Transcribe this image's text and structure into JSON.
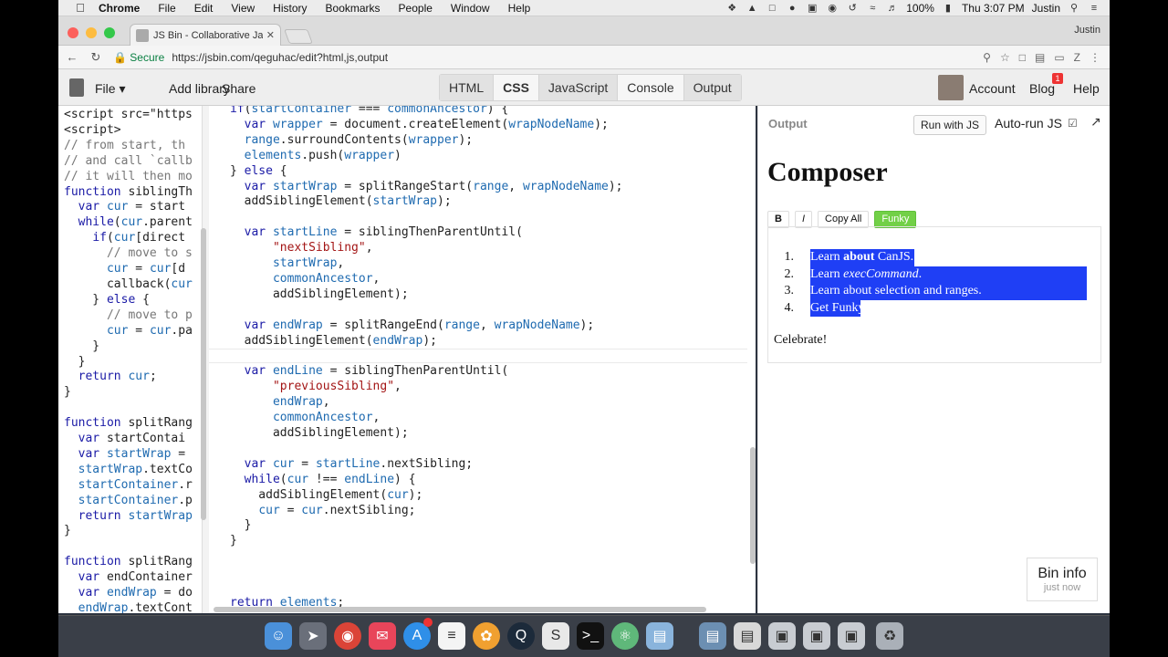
{
  "menubar": {
    "app_name": "Chrome",
    "items": [
      "File",
      "Edit",
      "View",
      "History",
      "Bookmarks",
      "People",
      "Window",
      "Help"
    ],
    "battery": "100%",
    "clock": "Thu 3:07 PM",
    "user": "Justin"
  },
  "browser": {
    "tab_title": "JS Bin - Collaborative JavaScr",
    "profile": "Justin",
    "secure_label": "Secure",
    "url": "https://jsbin.com/qeguhac/edit?html,js,output"
  },
  "toolbar": {
    "file": "File",
    "add_library": "Add library",
    "share": "Share",
    "panels": [
      "HTML",
      "CSS",
      "JavaScript",
      "Console",
      "Output"
    ],
    "account": "Account",
    "blog": "Blog",
    "blog_badge": "1",
    "help": "Help"
  },
  "html_editor": {
    "lines": [
      "<script src=\"https",
      "<script>",
      "// from start, th",
      "// and call `callb",
      "// it will then mo",
      "function siblingTh",
      "  var cur = start",
      "  while(cur.parent",
      "    if(cur[direct",
      "      // move to s",
      "      cur = cur[d",
      "      callback(cur",
      "    } else {",
      "      // move to p",
      "      cur = cur.pa",
      "    }",
      "  }",
      "  return cur;",
      "}",
      "",
      "function splitRang",
      "  var startContai",
      "  var startWrap =",
      "  startWrap.textCo",
      "  startContainer.r",
      "  startContainer.p",
      "  return startWrap",
      "}",
      "",
      "function splitRang",
      "  var endContainer",
      "  var endWrap = do",
      "  endWrap.textCont"
    ]
  },
  "js_editor": {
    "lines": [
      "if(startContainer === commonAncestor) {",
      "  var wrapper = document.createElement(wrapNodeName);",
      "  range.surroundContents(wrapper);",
      "  elements.push(wrapper)",
      "} else {",
      "  var startWrap = splitRangeStart(range, wrapNodeName);",
      "  addSiblingElement(startWrap);",
      "",
      "  var startLine = siblingThenParentUntil(",
      "      \"nextSibling\",",
      "      startWrap,",
      "      commonAncestor,",
      "      addSiblingElement);",
      "",
      "  var endWrap = splitRangeEnd(range, wrapNodeName);",
      "  addSiblingElement(endWrap);",
      "",
      "  var endLine = siblingThenParentUntil(",
      "      \"previousSibling\",",
      "      endWrap,",
      "      commonAncestor,",
      "      addSiblingElement);",
      "",
      "  var cur = startLine.nextSibling;",
      "  while(cur !== endLine) {",
      "    addSiblingElement(cur);",
      "    cur = cur.nextSibling;",
      "  }",
      "}",
      "",
      "",
      "",
      "return elements;"
    ]
  },
  "output": {
    "label": "Output",
    "run_button": "Run with JS",
    "autorun_label": "Auto-run JS",
    "heading": "Composer",
    "buttons": {
      "bold": "B",
      "italic": "I",
      "copy_all": "Copy All",
      "funky": "Funky"
    },
    "list": [
      {
        "num": "1.",
        "pre": "Learn ",
        "strong": "about",
        "post": " CanJS."
      },
      {
        "num": "2.",
        "pre": "Learn ",
        "em": "execCommand",
        "post": "."
      },
      {
        "num": "3.",
        "pre": "Learn about selection and ranges.",
        "post": ""
      },
      {
        "num": "4.",
        "pre": "Get Funky.",
        "post": ""
      }
    ],
    "celebrate": "Celebrate!"
  },
  "bin_info": {
    "title": "Bin info",
    "subtitle": "just now"
  },
  "colors": {
    "selection": "#1f3ff5",
    "funky_button": "#72d047",
    "keyword": "#1a1aa6",
    "string": "#a31515",
    "secure": "#0b8043"
  }
}
